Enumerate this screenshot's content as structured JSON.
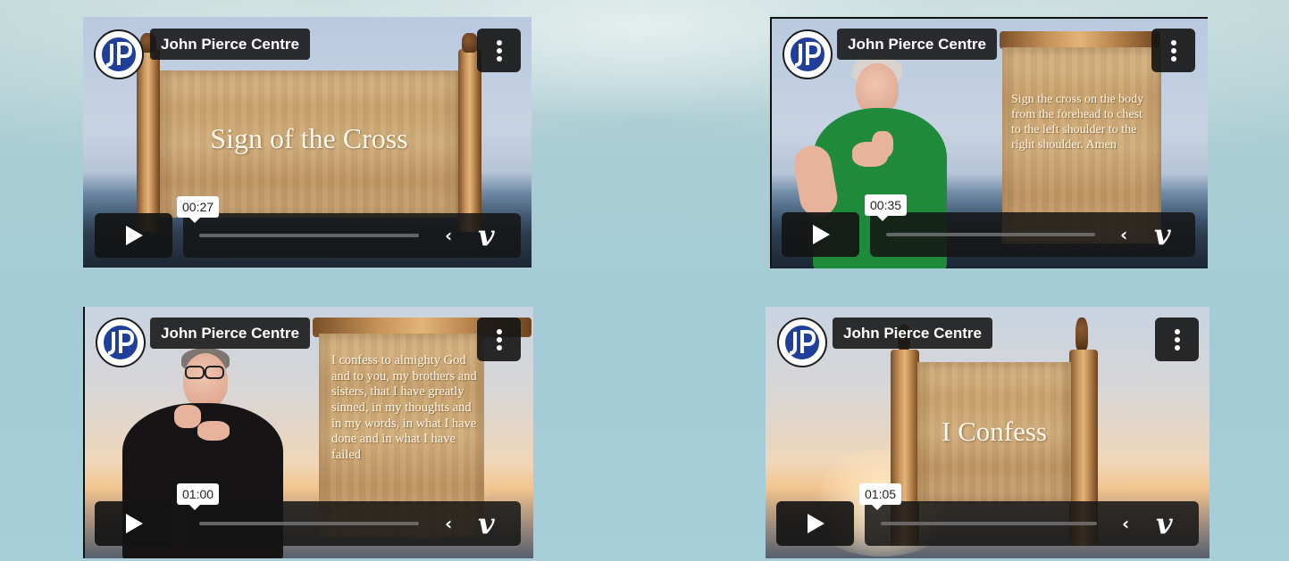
{
  "videos": [
    {
      "channel": "John Pierce Centre",
      "scroll_title": "Sign of the Cross",
      "scroll_text": "",
      "timestamp": "00:27"
    },
    {
      "channel": "John Pierce Centre",
      "scroll_title": "",
      "scroll_text": "Sign the cross on the body from the forehead to chest to the left shoulder to the right shoulder. Amen",
      "timestamp": "00:35"
    },
    {
      "channel": "John Pierce Centre",
      "scroll_title": "",
      "scroll_text": "I confess to almighty God and to you, my brothers and sisters, that I have greatly sinned, in my thoughts and in my words, in what I have done and in what I have failed",
      "timestamp": "01:00"
    },
    {
      "channel": "John Pierce Centre",
      "scroll_title": "I Confess",
      "scroll_text": "",
      "timestamp": "01:05"
    }
  ],
  "icons": {
    "logo": "jpc-logo-icon",
    "menu": "three-dots-vertical-icon",
    "play": "play-icon",
    "collapse": "chevron-left-icon",
    "vimeo": "vimeo-logo-icon"
  },
  "vimeo_glyph": "v",
  "chevron_glyph": "‹",
  "colors": {
    "control_bg": "#141414",
    "scroll_parchment": "#c9a26e",
    "green_dress": "#1e8a3a"
  }
}
